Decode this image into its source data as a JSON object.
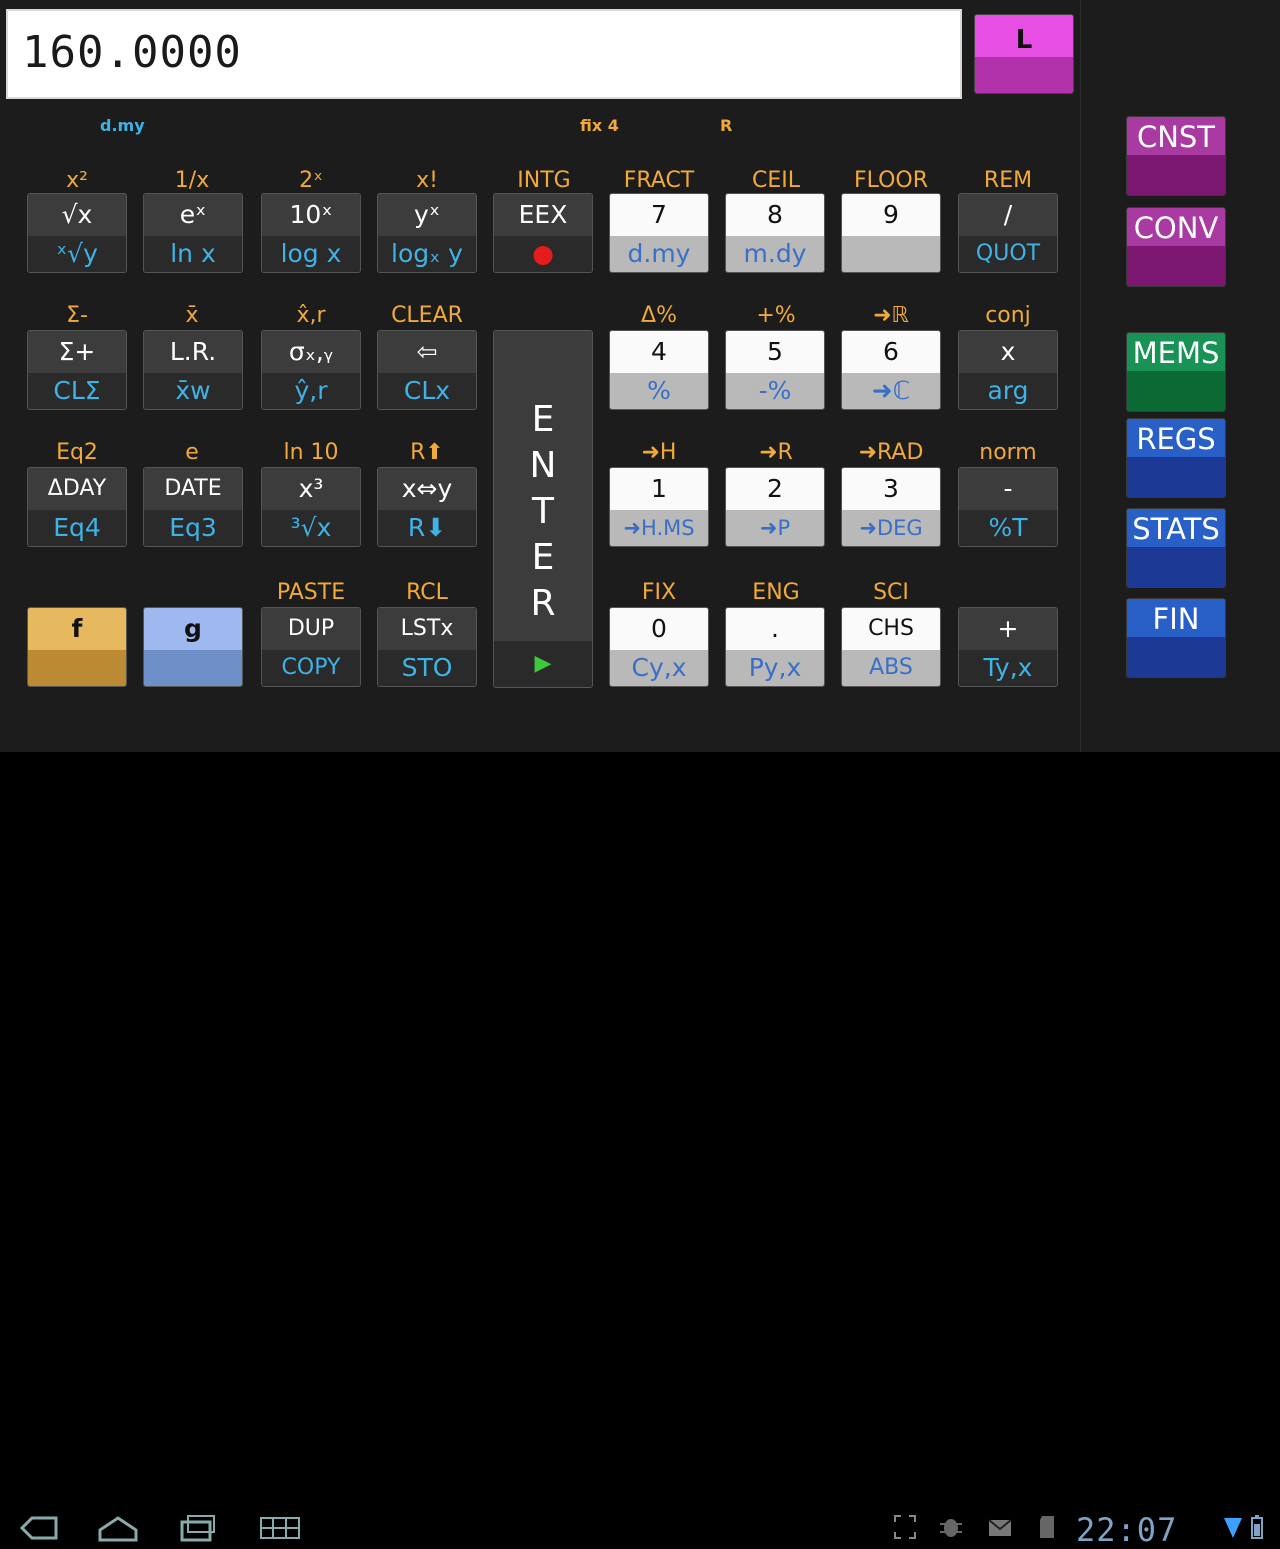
{
  "display": {
    "value": "160.0000",
    "l_button": "L"
  },
  "status": {
    "date_mode": "d.my",
    "format": "fix 4",
    "angle": "R"
  },
  "row1": {
    "alt": [
      "x²",
      "1/x",
      "2ˣ",
      "x!",
      "INTG",
      "FRACT",
      "CEIL",
      "FLOOR",
      "REM"
    ],
    "main": [
      "√x",
      "eˣ",
      "10ˣ",
      "yˣ",
      "EEX",
      "7",
      "8",
      "9",
      "/"
    ],
    "shift": [
      "ˣ√y",
      "ln x",
      "log x",
      "logₓ y",
      "●",
      "d.my",
      "m.dy",
      "",
      "QUOT"
    ]
  },
  "row2": {
    "alt": [
      "Σ-",
      "x̄",
      "x̂,r",
      "CLEAR",
      "Δ%",
      "+%",
      "➜ℝ",
      "conj"
    ],
    "main": [
      "Σ+",
      "L.R.",
      "σₓ,ᵧ",
      "⇦",
      "4",
      "5",
      "6",
      "x"
    ],
    "shift": [
      "CLΣ",
      "x̄w",
      "ŷ,r",
      "CLx",
      "%",
      "-%",
      "➜ℂ",
      "arg"
    ]
  },
  "row3": {
    "alt": [
      "Eq2",
      "e",
      "ln 10",
      "R⬆",
      "➜H",
      "➜R",
      "➜RAD",
      "norm"
    ],
    "main": [
      "ΔDAY",
      "DATE",
      "x³",
      "x⇔y",
      "1",
      "2",
      "3",
      "-"
    ],
    "shift": [
      "Eq4",
      "Eq3",
      "³√x",
      "R⬇",
      "➜H.MS",
      "➜P",
      "➜DEG",
      "%T"
    ]
  },
  "row4": {
    "alt": [
      "PASTE",
      "RCL",
      "FIX",
      "ENG",
      "SCI"
    ],
    "main": [
      "f",
      "g",
      "DUP",
      "LSTx",
      "0",
      ".",
      "CHS",
      "+"
    ],
    "shift": [
      "COPY",
      "STO",
      "Cy,x",
      "Py,x",
      "ABS",
      "Ty,x"
    ]
  },
  "enter": {
    "letters": [
      "E",
      "N",
      "T",
      "E",
      "R"
    ],
    "play": "▶"
  },
  "side_buttons": [
    "CNST",
    "CONV",
    "MEMS",
    "REGS",
    "STATS",
    "FIN"
  ],
  "system": {
    "time": "22:07"
  }
}
